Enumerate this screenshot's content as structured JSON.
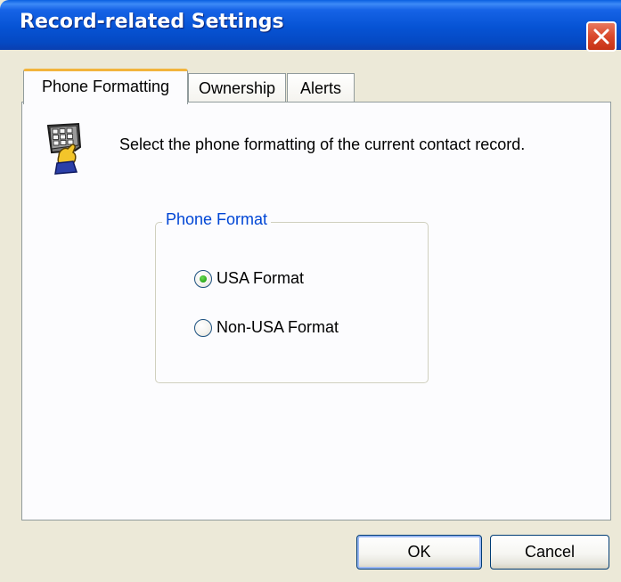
{
  "window": {
    "title": "Record-related Settings"
  },
  "tabs": [
    {
      "label": "Phone Formatting",
      "active": true
    },
    {
      "label": "Ownership",
      "active": false
    },
    {
      "label": "Alerts",
      "active": false
    }
  ],
  "panel": {
    "icon": "keypad-icon",
    "description": "Select the phone formatting of the current contact record."
  },
  "phone_format_group": {
    "legend": "Phone Format",
    "options": [
      {
        "label": "USA Format",
        "selected": true
      },
      {
        "label": "Non-USA Format",
        "selected": false
      }
    ]
  },
  "buttons": {
    "ok_label": "OK",
    "cancel_label": "Cancel"
  },
  "colors": {
    "titlebar_blue": "#0653d4",
    "tab_highlight": "#f2b43d",
    "groupbox_legend": "#0046d5",
    "close_red": "#d9482b",
    "dialog_background": "#ece9d8"
  }
}
